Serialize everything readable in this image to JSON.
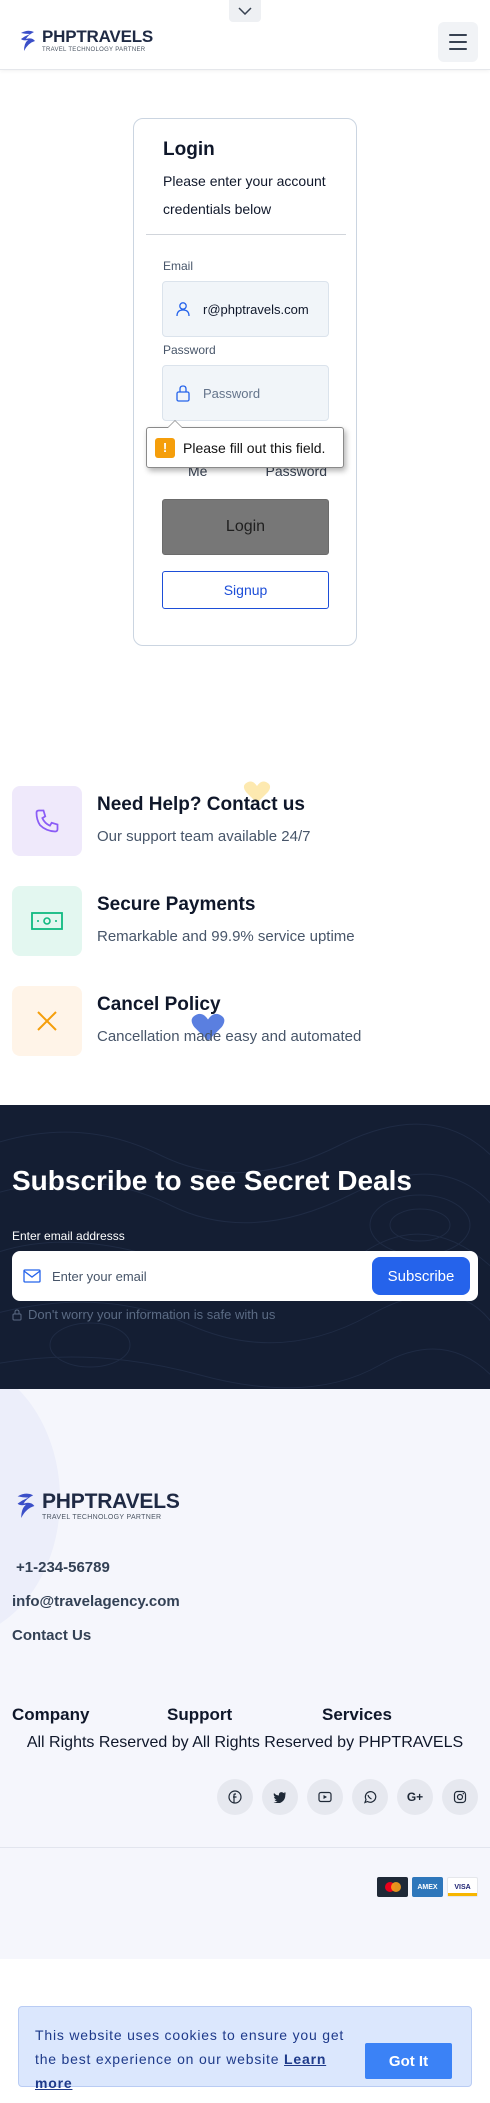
{
  "header": {
    "logo_name": "PHPTRAVELS",
    "logo_tagline": "TRAVEL TECHNOLOGY PARTNER"
  },
  "login": {
    "title": "Login",
    "subtitle": "Please enter your account credentials below",
    "email_label": "Email",
    "email_value": "r@phptravels.com",
    "password_label": "Password",
    "password_placeholder": "Password",
    "remember_label": "Me",
    "forgot_label": "Password",
    "login_button": "Login",
    "signup_button": "Signup",
    "validation_tooltip": "Please fill out this field.",
    "validation_icon": "!"
  },
  "features": [
    {
      "title": "Need Help? Contact us",
      "desc": "Our support team available 24/7",
      "icon": "phone-icon",
      "bg": "#efe9fb",
      "color": "#8b5cf6"
    },
    {
      "title": "Secure Payments",
      "desc": "Remarkable and 99.9% service uptime",
      "icon": "money-icon",
      "bg": "#e3f7f0",
      "color": "#10b981"
    },
    {
      "title": "Cancel Policy",
      "desc": "Cancellation made easy and automated",
      "icon": "close-icon",
      "bg": "#fff4e8",
      "color": "#f59e0b"
    }
  ],
  "subscribe": {
    "title": "Subscribe to see Secret Deals",
    "label": "Enter email addresss",
    "placeholder": "Enter your email",
    "button": "Subscribe",
    "note": "Don't worry your information is safe with us"
  },
  "footer": {
    "logo_name": "PHPTRAVELS",
    "logo_tagline": "TRAVEL TECHNOLOGY PARTNER",
    "phone": "+1-234-56789",
    "email": "info@travelagency.com",
    "contact": "Contact Us",
    "columns": [
      "Company",
      "Support",
      "Services"
    ],
    "copyright": "All Rights Reserved by All Rights Reserved by PHPTRAVELS",
    "socials": [
      "facebook-icon",
      "twitter-icon",
      "youtube-icon",
      "whatsapp-icon",
      "google-plus-icon",
      "instagram-icon"
    ],
    "google_plus_text": "G+",
    "payment_cards": [
      {
        "name": "mastercard-icon",
        "label": "",
        "color": "#1f2937"
      },
      {
        "name": "amex-icon",
        "label": "AMEX",
        "color": "#2e77bb"
      },
      {
        "name": "visa-icon",
        "label": "VISA",
        "color": "#ffffff"
      }
    ]
  },
  "cookie": {
    "text": "This website uses cookies to ensure you get the best experience on our website",
    "learn_more": "Learn more",
    "button": "Got It"
  }
}
